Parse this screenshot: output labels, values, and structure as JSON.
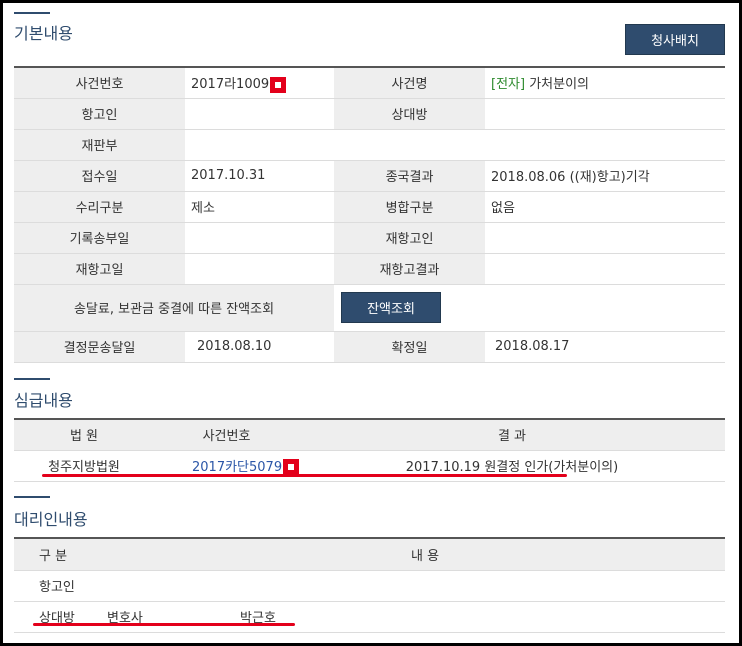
{
  "basic": {
    "title": "기본내용",
    "layout_button": "청사배치",
    "rows": {
      "case_no_label": "사건번호",
      "case_no_value": "2017라1009",
      "case_name_label": "사건명",
      "case_name_tag": "[전자]",
      "case_name_value": " 가처분이의",
      "appellant_label": "항고인",
      "appellant_value": "",
      "opponent_label": "상대방",
      "opponent_value": "",
      "division_label": "재판부",
      "division_value": "",
      "received_label": "접수일",
      "received_value": "2017.10.31",
      "final_result_label": "종국결과",
      "final_result_value": "2018.08.06 ((재)항고)기각",
      "accept_type_label": "수리구분",
      "accept_type_value": "제소",
      "merge_type_label": "병합구분",
      "merge_type_value": "없음",
      "record_sent_label": "기록송부일",
      "record_sent_value": "",
      "reappellant_label": "재항고인",
      "reappellant_value": "",
      "reappeal_date_label": "재항고일",
      "reappeal_date_value": "",
      "reappeal_result_label": "재항고결과",
      "reappeal_result_value": "",
      "balance_label": "송달료, 보관금 중결에 따른 잔액조회",
      "balance_button": "잔액조회",
      "decision_sent_label": "결정문송달일",
      "decision_sent_value": "2018.08.10",
      "confirmed_label": "확정일",
      "confirmed_value": "2018.08.17"
    }
  },
  "lower": {
    "title": "심급내용",
    "headers": {
      "court": "법 원",
      "case_no": "사건번호",
      "result": "결 과"
    },
    "row": {
      "court": "청주지방법원",
      "case_no": "2017카단5079",
      "result": "2017.10.19 원결정 인가(가처분이의)"
    }
  },
  "agent": {
    "title": "대리인내용",
    "headers": {
      "type": "구 분",
      "content": "내 용"
    },
    "rows": [
      {
        "type": "항고인",
        "role": "",
        "name": ""
      },
      {
        "type": "상대방",
        "role": "변호사",
        "name": "박근호"
      }
    ]
  },
  "colors": {
    "accent": "#2f4c6e",
    "redaction": "#e3001b",
    "tag_green": "#2e8b2e",
    "link": "#2b56a7"
  }
}
